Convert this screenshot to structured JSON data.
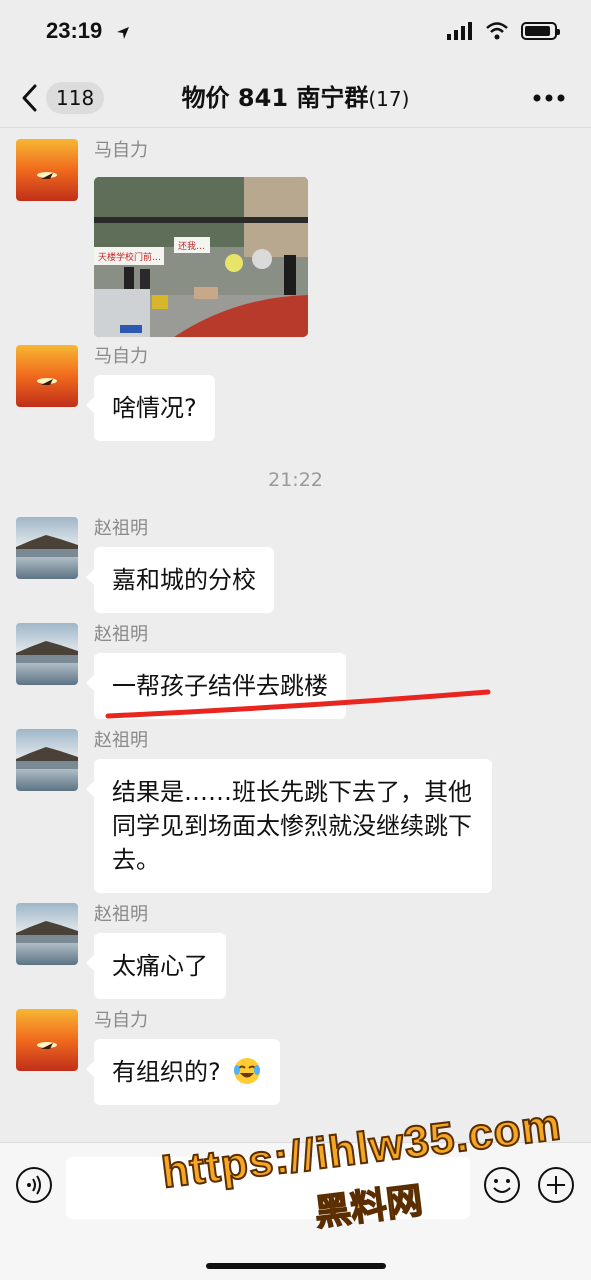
{
  "status": {
    "time": "23:19"
  },
  "nav": {
    "unread_count": "118",
    "title": "物价 841 南宁群",
    "member_count": "(17)"
  },
  "messages": [
    {
      "sender": "马自力",
      "type": "image",
      "avatar": "sunset"
    },
    {
      "sender": "马自力",
      "text": "啥情况?",
      "avatar": "sunset"
    },
    {
      "sender": "赵祖明",
      "text": "嘉和城的分校",
      "avatar": "lake"
    },
    {
      "sender": "赵祖明",
      "text": "一帮孩子结伴去跳楼",
      "avatar": "lake"
    },
    {
      "sender": "赵祖明",
      "text": "结果是……班长先跳下去了，其他同学见到场面太惨烈就没继续跳下去。",
      "avatar": "lake"
    },
    {
      "sender": "赵祖明",
      "text": "太痛心了",
      "avatar": "lake"
    },
    {
      "sender": "马自力",
      "text": "有组织的?",
      "avatar": "sunset",
      "emoji": "crying-laughing-emoji"
    }
  ],
  "timestamps": [
    "21:22"
  ],
  "photo": {
    "banner_left": "天楼学校门前…",
    "banner_right": "还我…"
  },
  "watermark": {
    "url": "https://ihlw35.com",
    "label": "黑料网"
  },
  "colors": {
    "annotation": "#e8251f",
    "watermark": "#f5a623"
  }
}
